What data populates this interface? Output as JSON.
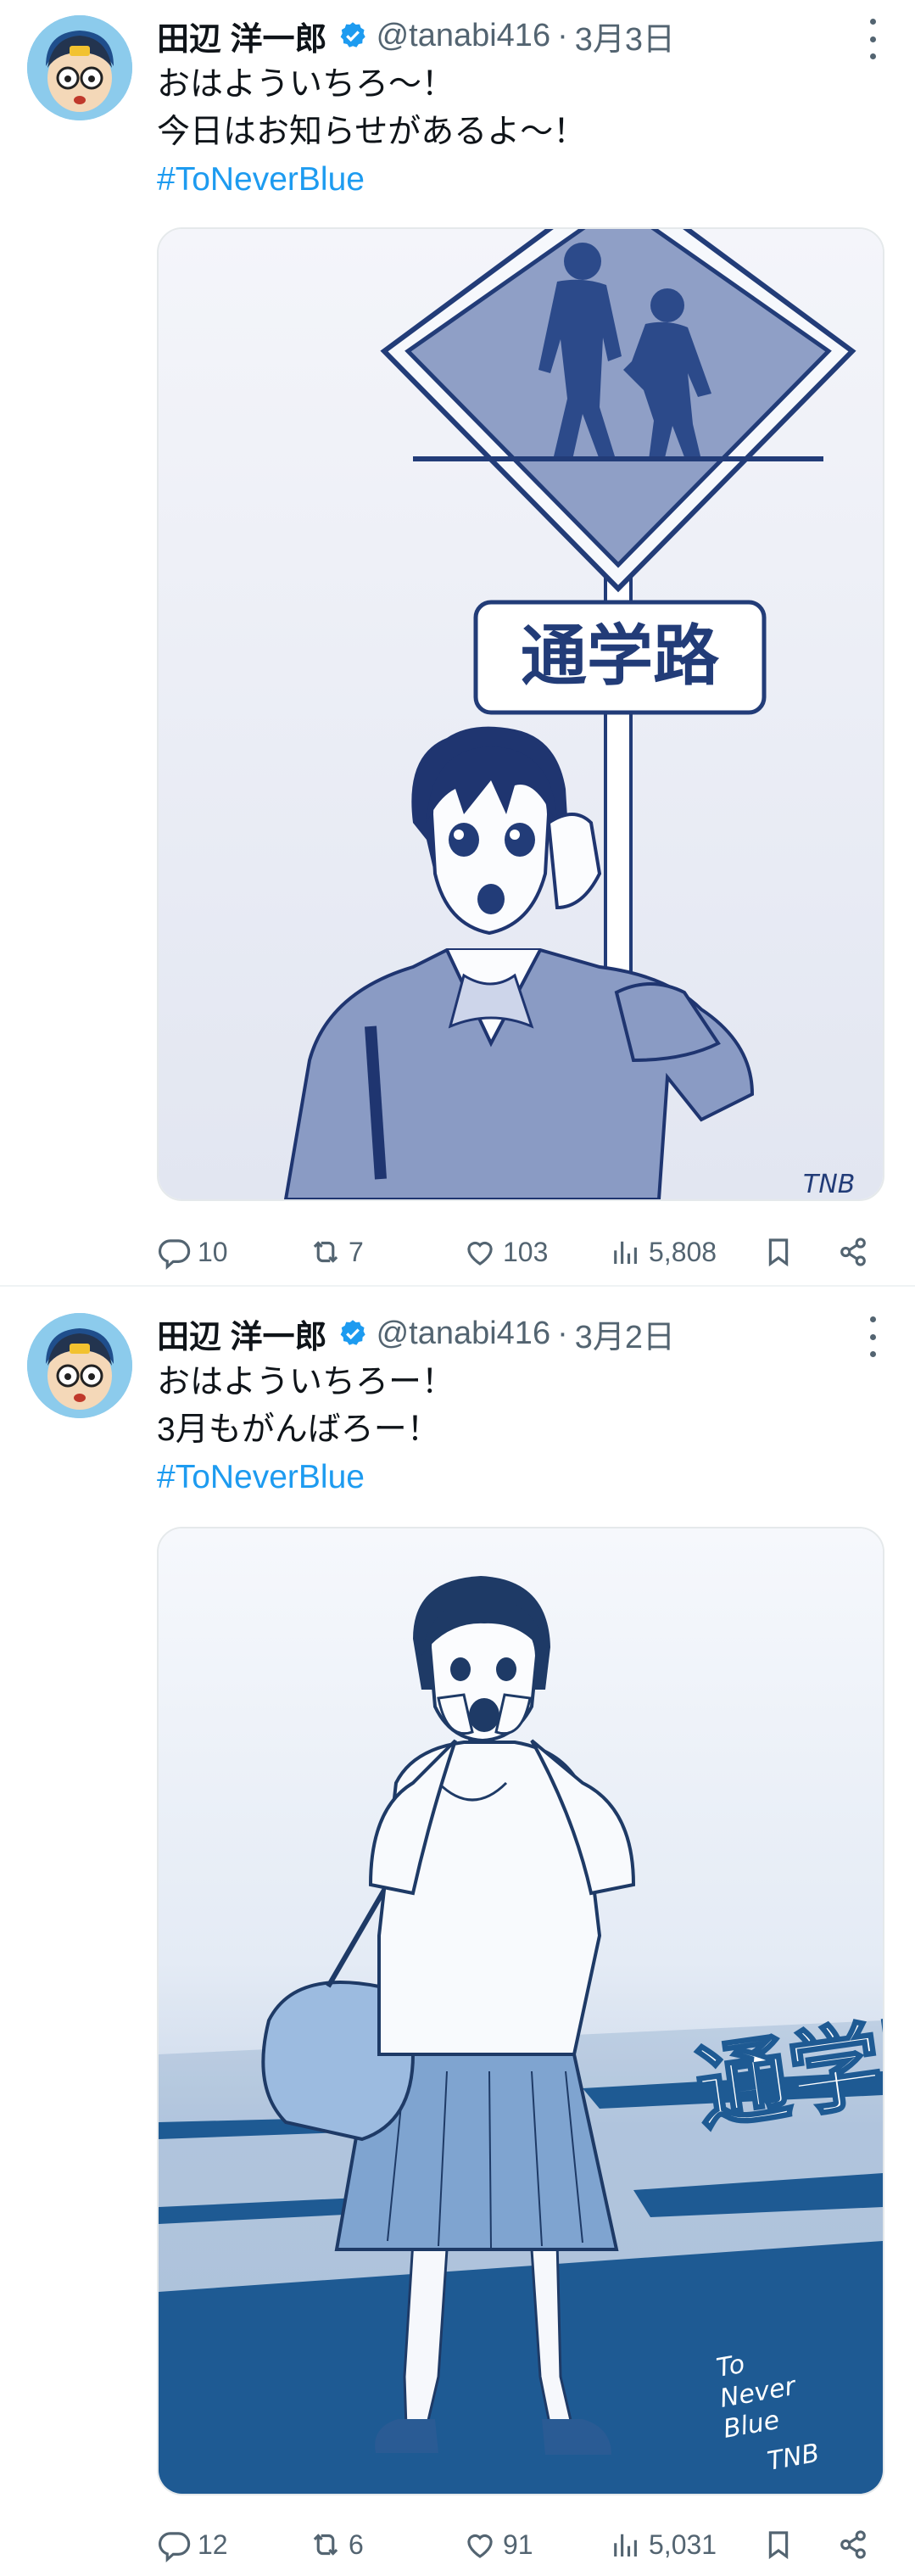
{
  "tweets": [
    {
      "author": {
        "name": "田辺 洋一郎",
        "handle": "@tanabi416",
        "verified": true,
        "avatar_icon": "avatar-face-icon"
      },
      "date": "3月3日",
      "lines": [
        "おはよういちろ～！",
        "今日はお知らせがあるよ～！"
      ],
      "hashtag": "#ToNeverBlue",
      "image": {
        "sign_text": "通学路",
        "signature": "TNB",
        "description_icon": "crossing-sign-illustration"
      },
      "stats": {
        "replies": "10",
        "retweets": "7",
        "likes": "103",
        "views": "5,808"
      }
    },
    {
      "author": {
        "name": "田辺 洋一郎",
        "handle": "@tanabi416",
        "verified": true,
        "avatar_icon": "avatar-face-icon"
      },
      "date": "3月2日",
      "lines": [
        "おはよういちろー！",
        "3月もがんばろー！"
      ],
      "hashtag": "#ToNeverBlue",
      "image": {
        "road_text": "通学路",
        "signature_lines": [
          "To",
          "Never",
          "Blue",
          "TNB"
        ],
        "description_icon": "schoolgirl-illustration"
      },
      "stats": {
        "replies": "12",
        "retweets": "6",
        "likes": "91",
        "views": "5,031"
      }
    }
  ],
  "separator_symbol": "·",
  "colors": {
    "accent": "#1d9bf0",
    "muted": "#536471",
    "illustration": "#1f4e8c",
    "border": "#e5e9eb"
  }
}
